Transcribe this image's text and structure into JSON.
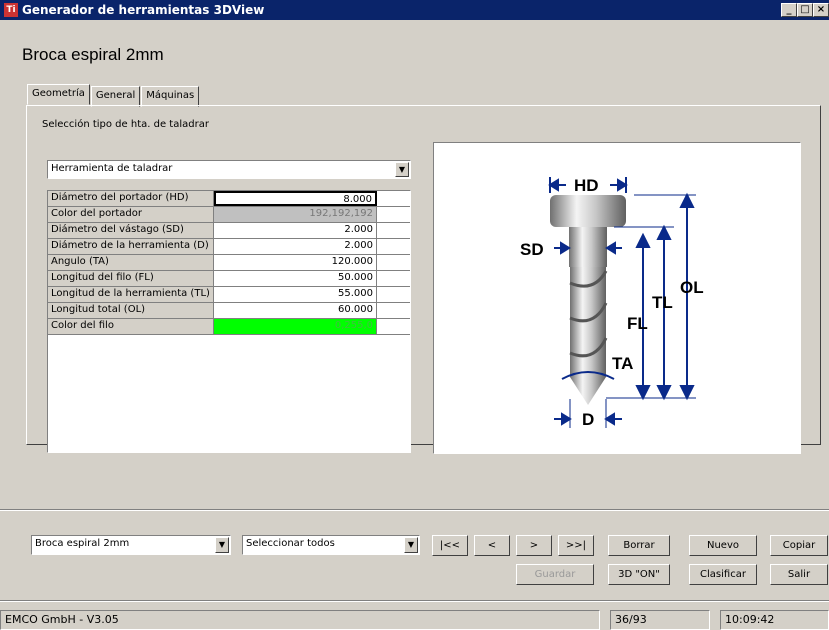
{
  "window": {
    "title": "Generador de herramientas 3DView",
    "app_icon": "Ti",
    "controls": [
      "_",
      "□",
      "×"
    ]
  },
  "tool_title": "Broca espiral 2mm",
  "tabs": [
    {
      "label": "Geometría",
      "active": true
    },
    {
      "label": "General",
      "active": false
    },
    {
      "label": "Máquinas",
      "active": false
    }
  ],
  "selection": {
    "label": "Selección tipo de hta. de taladrar",
    "value": "Herramienta de taladrar"
  },
  "params": [
    {
      "label": "Diámetro del portador (HD)",
      "value": "8.000",
      "style": "edit"
    },
    {
      "label": "Color del portador",
      "value": "192,192,192",
      "style": "grey"
    },
    {
      "label": "Diámetro del vástago (SD)",
      "value": "2.000",
      "style": ""
    },
    {
      "label": "Diámetro de la herramienta (D)",
      "value": "2.000",
      "style": ""
    },
    {
      "label": "Angulo (TA)",
      "value": "120.000",
      "style": ""
    },
    {
      "label": "Longitud del filo (FL)",
      "value": "50.000",
      "style": ""
    },
    {
      "label": "Longitud de la herramienta (TL)",
      "value": "55.000",
      "style": ""
    },
    {
      "label": "Longitud total (OL)",
      "value": "60.000",
      "style": ""
    },
    {
      "label": "Color del filo",
      "value": "0,255,0",
      "style": "green"
    }
  ],
  "diagram_labels": {
    "hd": "HD",
    "sd": "SD",
    "ol": "OL",
    "tl": "TL",
    "fl": "FL",
    "ta": "TA",
    "d": "D"
  },
  "bottom": {
    "tool_combo": "Broca espiral 2mm",
    "filter_combo": "Seleccionar todos",
    "nav": {
      "first": "|<<",
      "prev": "<",
      "next": ">",
      "last": ">>|"
    },
    "buttons": {
      "borrar": "Borrar",
      "nuevo": "Nuevo",
      "copiar": "Copiar",
      "guardar": "Guardar",
      "view3d": "3D \"ON\"",
      "clasificar": "Clasificar",
      "salir": "Salir"
    }
  },
  "status": {
    "company": "EMCO GmbH  -  V3.05",
    "count": "36/93",
    "time": "10:09:42"
  },
  "colors": {
    "titlebar": "#0a246a",
    "edge_color": "#00ff00",
    "holder_color": "#c0c0c0",
    "dim_blue": "#0a2a8a"
  }
}
